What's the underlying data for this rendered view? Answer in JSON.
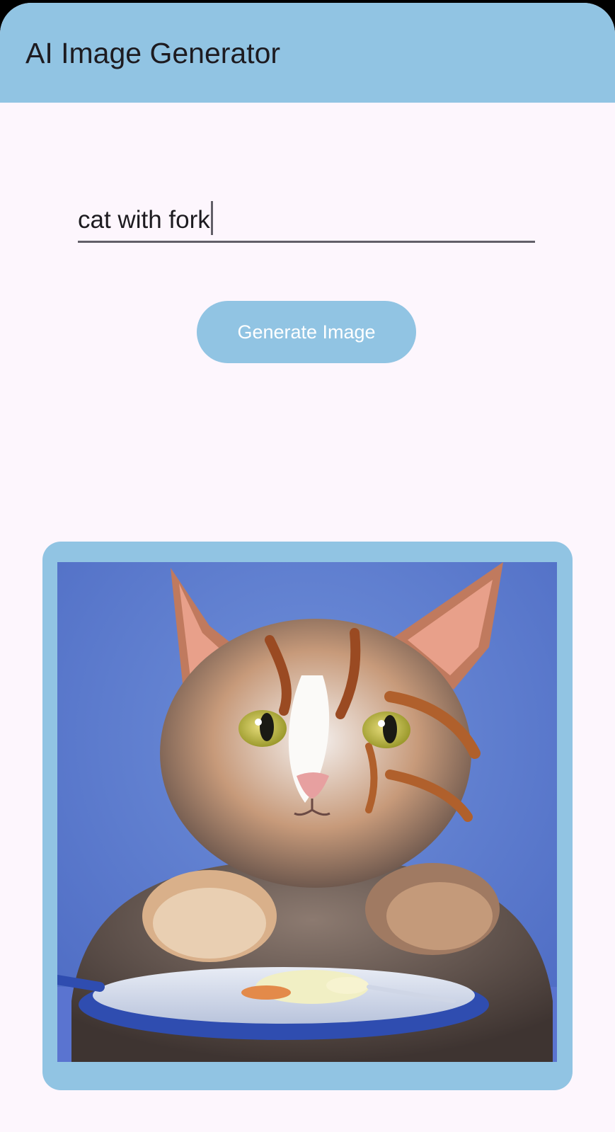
{
  "app_bar": {
    "title": "AI Image Generator"
  },
  "prompt": {
    "value": "cat with fork"
  },
  "generate_button": {
    "label": "Generate Image"
  },
  "result_image": {
    "depicts": "cat-at-plate"
  },
  "colors": {
    "accent": "#91c4e3",
    "background": "#fdf6fd",
    "text": "#1d1b20",
    "underline": "#625f68"
  }
}
